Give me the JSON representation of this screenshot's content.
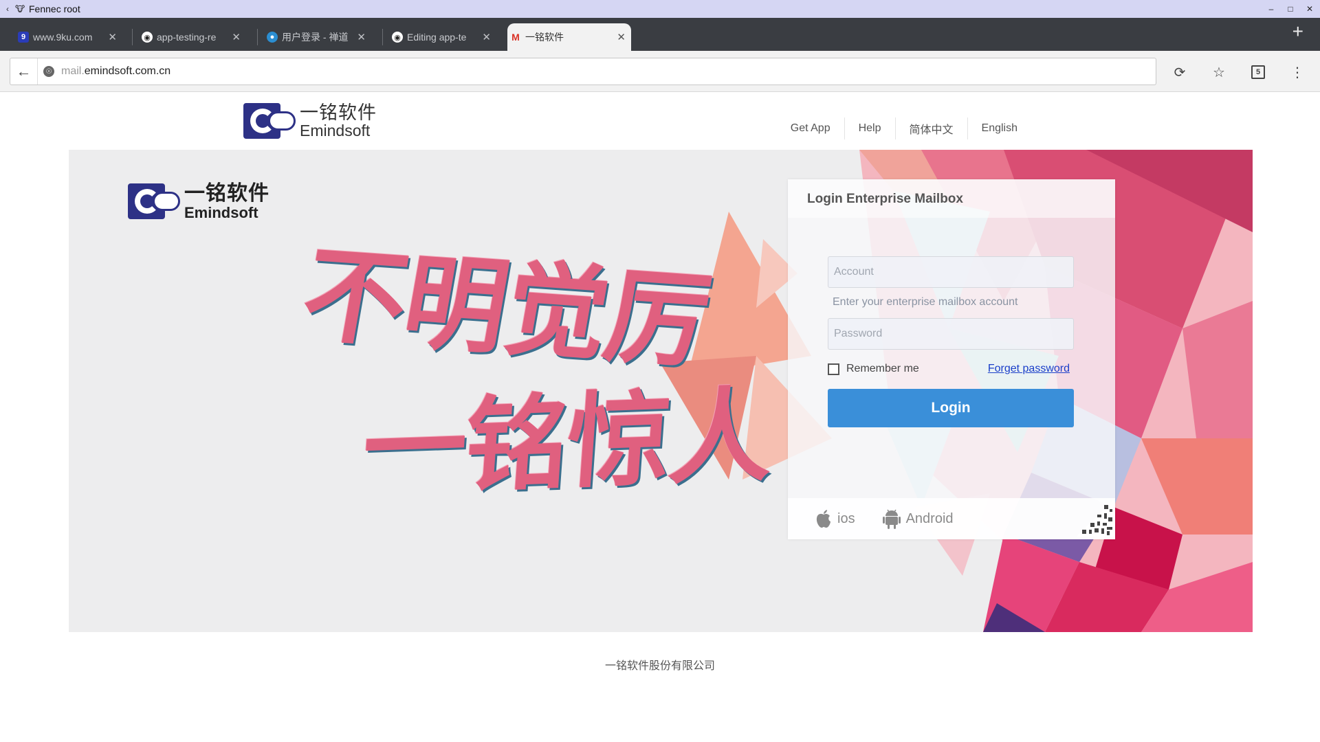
{
  "window": {
    "title": "Fennec root"
  },
  "tabs": [
    {
      "title": "www.9ku.com",
      "favicon": "9ku-icon"
    },
    {
      "title": "app-testing-re",
      "favicon": "github-icon"
    },
    {
      "title": "用户登录 - 禅道",
      "favicon": "zentao-icon"
    },
    {
      "title": "Editing app-te",
      "favicon": "github-icon"
    },
    {
      "title": "一铭软件",
      "favicon": "gmail-m-icon",
      "active": true
    }
  ],
  "address_bar": {
    "url_prefix": "mail.",
    "url_domain": "emindsoft.com.cn",
    "tab_count": "5"
  },
  "header": {
    "logo": {
      "cn": "一铭软件",
      "en": "Emindsoft"
    },
    "nav": [
      "Get App",
      "Help",
      "简体中文",
      "English"
    ]
  },
  "banner": {
    "logo": {
      "cn": "一铭软件",
      "en": "Emindsoft"
    },
    "slogan_line1": "不明觉厉",
    "slogan_line2": "一铭惊人"
  },
  "login": {
    "title": "Login Enterprise Mailbox",
    "account_placeholder": "Account",
    "account_hint": "Enter your enterprise mailbox account",
    "password_placeholder": "Password",
    "remember_label": "Remember me",
    "forget_label": "Forget password",
    "login_label": "Login",
    "apps": [
      "ios",
      "Android"
    ]
  },
  "footer": {
    "text": "一铭软件股份有限公司"
  },
  "colors": {
    "accent": "#3a8fd9",
    "brand": "#2d3186",
    "slogan": "#e0607f"
  }
}
